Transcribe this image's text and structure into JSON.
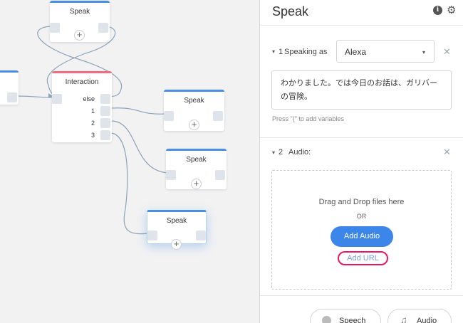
{
  "canvas": {
    "blocks": [
      {
        "title": "Speak"
      },
      {
        "title": "Interaction",
        "choices": [
          "else",
          "1",
          "2",
          "3"
        ]
      },
      {
        "title": "Speak"
      },
      {
        "title": "Speak"
      },
      {
        "title": "Speak"
      }
    ],
    "plus_glyph": "+"
  },
  "panel": {
    "title": "Speak",
    "info_glyph": "i",
    "gear_glyph": "⚙",
    "sections": [
      {
        "caret": "▾",
        "index": "1",
        "label": "Speaking as",
        "voice": "Alexa",
        "voice_arrow": "▾",
        "close": "✕",
        "text": "わかりました。では今日のお話は、ガリバーの冒険。",
        "hint": "Press \"{\" to add variables"
      },
      {
        "caret": "▾",
        "index": "2",
        "label": "Audio:",
        "close": "✕",
        "drop_text": "Drag and Drop files here",
        "or_text": "OR",
        "add_audio_label": "Add Audio",
        "add_url_label": "Add URL"
      }
    ],
    "bottom_buttons": [
      {
        "label": "Speech",
        "icon": "speech-icon"
      },
      {
        "label": "Audio",
        "icon": "music-note-icon",
        "glyph": "♫"
      }
    ]
  }
}
